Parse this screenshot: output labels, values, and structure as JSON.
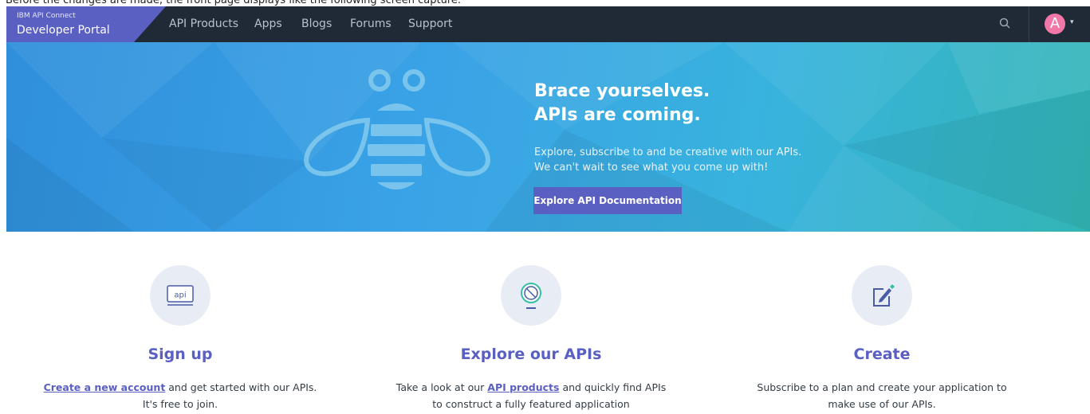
{
  "caption": "Before the changes are made, the front page displays like the following screen capture.",
  "navbar": {
    "brand_small": "IBM API Connect",
    "brand_big": "Developer Portal",
    "items": [
      {
        "label": "API Products"
      },
      {
        "label": "Apps"
      },
      {
        "label": "Blogs"
      },
      {
        "label": "Forums"
      },
      {
        "label": "Support"
      }
    ],
    "search_icon": "search-icon",
    "avatar_letter": "A",
    "avatar_color": "#f277a9",
    "caret": "▾"
  },
  "hero": {
    "title_line1": "Brace yourselves.",
    "title_line2": "APIs are coming.",
    "sub_line1": "Explore, subscribe to and be creative with our APIs.",
    "sub_line2": "We can't wait to see what you come up with!",
    "button_label": "Explore API Documentation",
    "button_color": "#5a5fc2"
  },
  "features": [
    {
      "icon": "api-icon",
      "icon_text": "api",
      "title": "Sign up",
      "link": "Create a new account",
      "text_after": " and get started with our APIs.",
      "line2": "It's free to join."
    },
    {
      "icon": "globe-icon",
      "title": "Explore our APIs",
      "text_before": "Take a look at our ",
      "link": "API products",
      "text_after": " and quickly find APIs",
      "line2": "to construct a fully featured application"
    },
    {
      "icon": "edit-icon",
      "title": "Create",
      "line1": "Subscribe to a plan and create your application to",
      "line2": "make use of our APIs."
    }
  ],
  "colors": {
    "navbar_bg": "#1f2a36",
    "accent": "#5a5fc2",
    "hero_start": "#2f8fdb",
    "hero_end": "#32b5b5"
  }
}
